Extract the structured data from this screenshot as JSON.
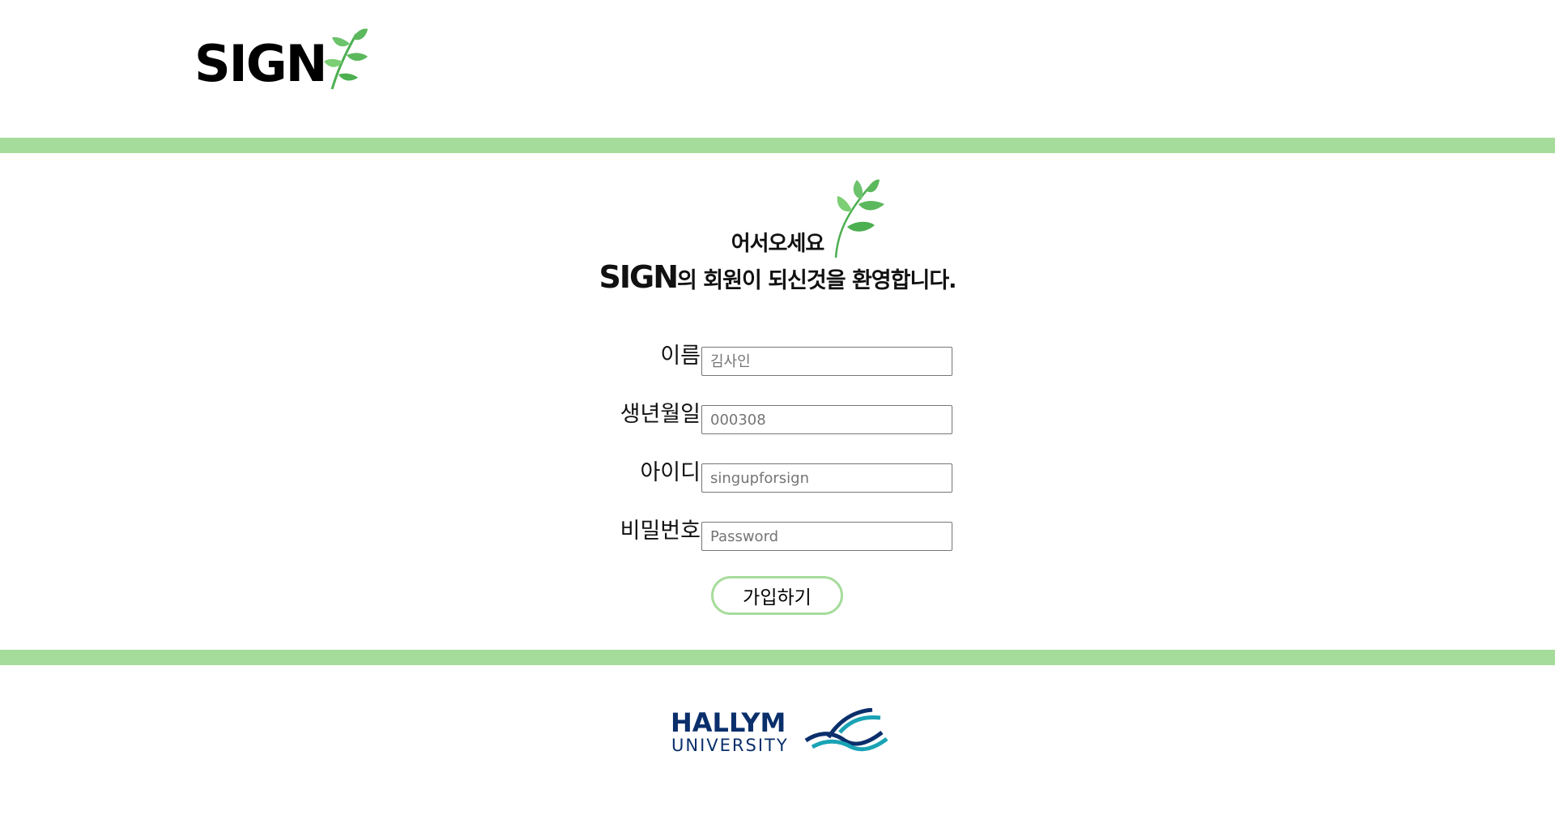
{
  "header": {
    "logo_text": "SIGN"
  },
  "welcome": {
    "greeting": "어서오세요",
    "brand": "SIGN",
    "message": "의 회원이 되신것을 환영합니다."
  },
  "form": {
    "fields": [
      {
        "label": "이름",
        "placeholder": "김사인"
      },
      {
        "label": "생년월일",
        "placeholder": "000308"
      },
      {
        "label": "아이디",
        "placeholder": "singupforsign"
      },
      {
        "label": "비밀번호",
        "placeholder": "Password"
      }
    ],
    "submit_label": "가입하기"
  },
  "footer": {
    "university_name": "HALLYM",
    "university_sub": "UNIVERSITY"
  },
  "colors": {
    "accent_green": "#a6dc9b",
    "leaf_green": "#4caf50",
    "hallym_navy": "#0a2f6b",
    "hallym_teal": "#1aa3b5"
  }
}
